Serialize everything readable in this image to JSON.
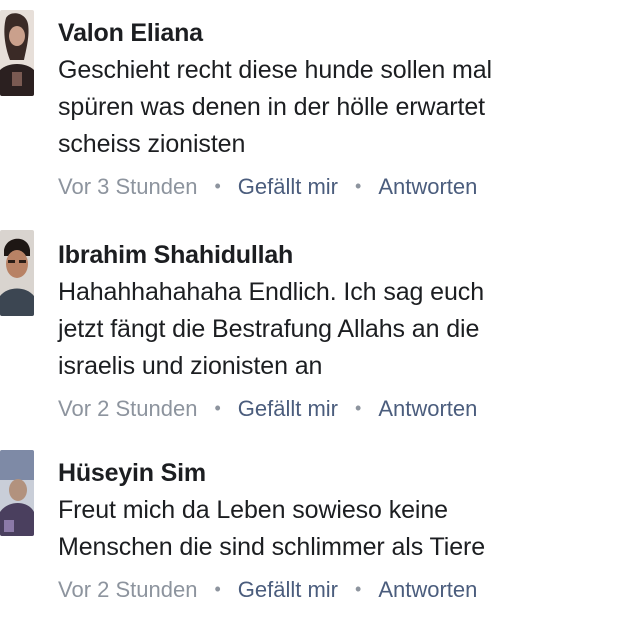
{
  "comments": [
    {
      "author": "Valon Eliana",
      "lines": [
        "Geschieht recht diese hunde sollen mal",
        "spüren was denen in der hölle erwartet",
        "scheiss zionisten"
      ],
      "time": "Vor 3 Stunden",
      "like_label": "Gefällt mir",
      "reply_label": "Antworten",
      "separator": "•"
    },
    {
      "author": "Ibrahim Shahidullah",
      "lines": [
        "Hahahhahahaha Endlich. Ich sag euch",
        "jetzt fängt die Bestrafung Allahs an die",
        "israelis und zionisten an"
      ],
      "time": "Vor 2 Stunden",
      "like_label": "Gefällt mir",
      "reply_label": "Antworten",
      "separator": "•"
    },
    {
      "author": "Hüseyin Sim",
      "lines": [
        "Freut mich da Leben sowieso keine",
        "Menschen die sind schlimmer als Tiere"
      ],
      "time": "Vor 2 Stunden",
      "like_label": "Gefällt mir",
      "reply_label": "Antworten",
      "separator": "•"
    }
  ],
  "colors": {
    "text": "#1c1e21",
    "meta": "#8d949e",
    "action": "#4b5d7d"
  }
}
